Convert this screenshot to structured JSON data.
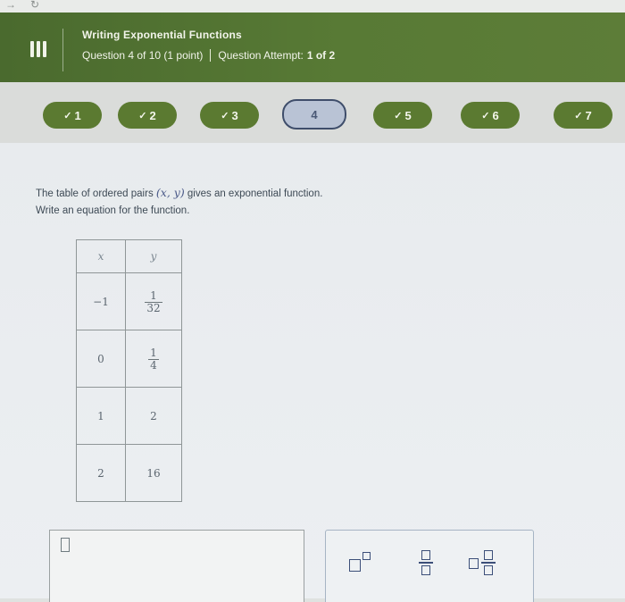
{
  "header": {
    "assignment_title": "Writing Exponential Functions",
    "question_position": "Question 4 of 10 (1 point)",
    "attempt_label": "Question Attempt:",
    "attempt_value": "1 of 2"
  },
  "progress": {
    "questions": [
      {
        "label": "1",
        "status": "complete"
      },
      {
        "label": "2",
        "status": "complete"
      },
      {
        "label": "3",
        "status": "complete"
      },
      {
        "label": "4",
        "status": "current"
      },
      {
        "label": "5",
        "status": "complete"
      },
      {
        "label": "6",
        "status": "complete"
      },
      {
        "label": "7",
        "status": "complete"
      }
    ]
  },
  "problem": {
    "line1_before": "The table of ordered pairs ",
    "pair": "(x, y)",
    "line1_after": " gives an exponential function.",
    "line2": "Write an equation for the function.",
    "table": {
      "header_x": "x",
      "header_y": "y",
      "rows": [
        {
          "x": "−1",
          "y_num": "1",
          "y_den": "32"
        },
        {
          "x": "0",
          "y_num": "1",
          "y_den": "4"
        },
        {
          "x": "1",
          "y": "2"
        },
        {
          "x": "2",
          "y": "16"
        }
      ]
    }
  },
  "colors": {
    "header_green": "#587a35",
    "complete_green": "#5b7a31",
    "current_blue": "#b9c3d5",
    "toolbar_icon": "#3c4f79"
  },
  "toolbar": {
    "icons": [
      "superscript-icon",
      "fraction-icon",
      "mixed-number-icon"
    ]
  }
}
